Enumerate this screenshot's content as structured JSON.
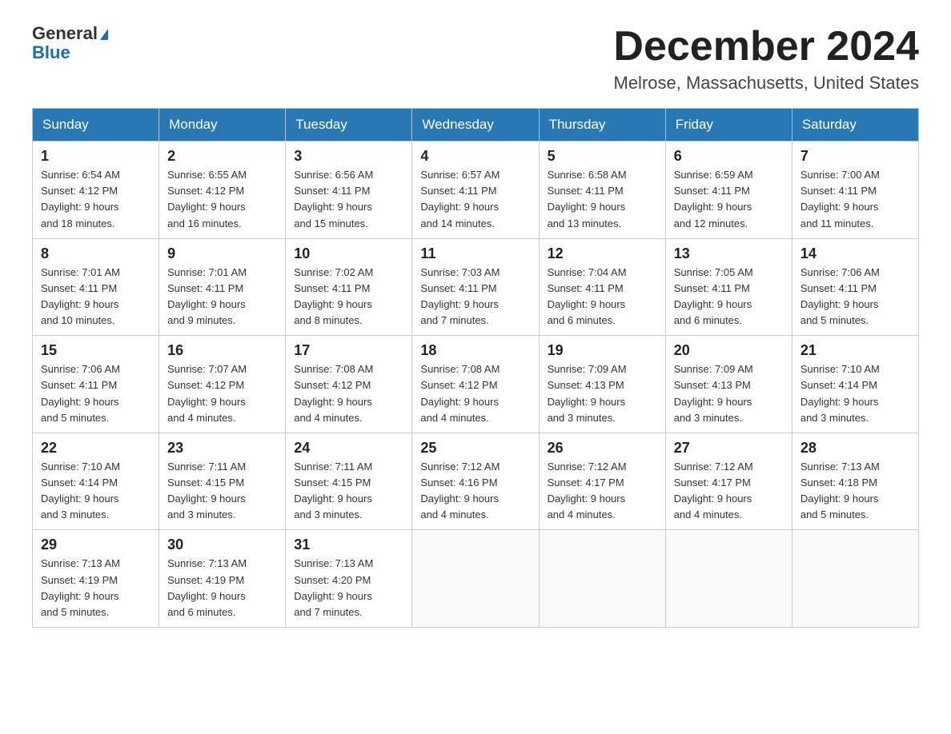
{
  "logo": {
    "line1": "General",
    "line2": "Blue"
  },
  "title": "December 2024",
  "subtitle": "Melrose, Massachusetts, United States",
  "days_of_week": [
    "Sunday",
    "Monday",
    "Tuesday",
    "Wednesday",
    "Thursday",
    "Friday",
    "Saturday"
  ],
  "weeks": [
    [
      {
        "day": "1",
        "sunrise": "6:54 AM",
        "sunset": "4:12 PM",
        "daylight": "9 hours and 18 minutes."
      },
      {
        "day": "2",
        "sunrise": "6:55 AM",
        "sunset": "4:12 PM",
        "daylight": "9 hours and 16 minutes."
      },
      {
        "day": "3",
        "sunrise": "6:56 AM",
        "sunset": "4:11 PM",
        "daylight": "9 hours and 15 minutes."
      },
      {
        "day": "4",
        "sunrise": "6:57 AM",
        "sunset": "4:11 PM",
        "daylight": "9 hours and 14 minutes."
      },
      {
        "day": "5",
        "sunrise": "6:58 AM",
        "sunset": "4:11 PM",
        "daylight": "9 hours and 13 minutes."
      },
      {
        "day": "6",
        "sunrise": "6:59 AM",
        "sunset": "4:11 PM",
        "daylight": "9 hours and 12 minutes."
      },
      {
        "day": "7",
        "sunrise": "7:00 AM",
        "sunset": "4:11 PM",
        "daylight": "9 hours and 11 minutes."
      }
    ],
    [
      {
        "day": "8",
        "sunrise": "7:01 AM",
        "sunset": "4:11 PM",
        "daylight": "9 hours and 10 minutes."
      },
      {
        "day": "9",
        "sunrise": "7:01 AM",
        "sunset": "4:11 PM",
        "daylight": "9 hours and 9 minutes."
      },
      {
        "day": "10",
        "sunrise": "7:02 AM",
        "sunset": "4:11 PM",
        "daylight": "9 hours and 8 minutes."
      },
      {
        "day": "11",
        "sunrise": "7:03 AM",
        "sunset": "4:11 PM",
        "daylight": "9 hours and 7 minutes."
      },
      {
        "day": "12",
        "sunrise": "7:04 AM",
        "sunset": "4:11 PM",
        "daylight": "9 hours and 6 minutes."
      },
      {
        "day": "13",
        "sunrise": "7:05 AM",
        "sunset": "4:11 PM",
        "daylight": "9 hours and 6 minutes."
      },
      {
        "day": "14",
        "sunrise": "7:06 AM",
        "sunset": "4:11 PM",
        "daylight": "9 hours and 5 minutes."
      }
    ],
    [
      {
        "day": "15",
        "sunrise": "7:06 AM",
        "sunset": "4:11 PM",
        "daylight": "9 hours and 5 minutes."
      },
      {
        "day": "16",
        "sunrise": "7:07 AM",
        "sunset": "4:12 PM",
        "daylight": "9 hours and 4 minutes."
      },
      {
        "day": "17",
        "sunrise": "7:08 AM",
        "sunset": "4:12 PM",
        "daylight": "9 hours and 4 minutes."
      },
      {
        "day": "18",
        "sunrise": "7:08 AM",
        "sunset": "4:12 PM",
        "daylight": "9 hours and 4 minutes."
      },
      {
        "day": "19",
        "sunrise": "7:09 AM",
        "sunset": "4:13 PM",
        "daylight": "9 hours and 3 minutes."
      },
      {
        "day": "20",
        "sunrise": "7:09 AM",
        "sunset": "4:13 PM",
        "daylight": "9 hours and 3 minutes."
      },
      {
        "day": "21",
        "sunrise": "7:10 AM",
        "sunset": "4:14 PM",
        "daylight": "9 hours and 3 minutes."
      }
    ],
    [
      {
        "day": "22",
        "sunrise": "7:10 AM",
        "sunset": "4:14 PM",
        "daylight": "9 hours and 3 minutes."
      },
      {
        "day": "23",
        "sunrise": "7:11 AM",
        "sunset": "4:15 PM",
        "daylight": "9 hours and 3 minutes."
      },
      {
        "day": "24",
        "sunrise": "7:11 AM",
        "sunset": "4:15 PM",
        "daylight": "9 hours and 3 minutes."
      },
      {
        "day": "25",
        "sunrise": "7:12 AM",
        "sunset": "4:16 PM",
        "daylight": "9 hours and 4 minutes."
      },
      {
        "day": "26",
        "sunrise": "7:12 AM",
        "sunset": "4:17 PM",
        "daylight": "9 hours and 4 minutes."
      },
      {
        "day": "27",
        "sunrise": "7:12 AM",
        "sunset": "4:17 PM",
        "daylight": "9 hours and 4 minutes."
      },
      {
        "day": "28",
        "sunrise": "7:13 AM",
        "sunset": "4:18 PM",
        "daylight": "9 hours and 5 minutes."
      }
    ],
    [
      {
        "day": "29",
        "sunrise": "7:13 AM",
        "sunset": "4:19 PM",
        "daylight": "9 hours and 5 minutes."
      },
      {
        "day": "30",
        "sunrise": "7:13 AM",
        "sunset": "4:19 PM",
        "daylight": "9 hours and 6 minutes."
      },
      {
        "day": "31",
        "sunrise": "7:13 AM",
        "sunset": "4:20 PM",
        "daylight": "9 hours and 7 minutes."
      },
      null,
      null,
      null,
      null
    ]
  ]
}
